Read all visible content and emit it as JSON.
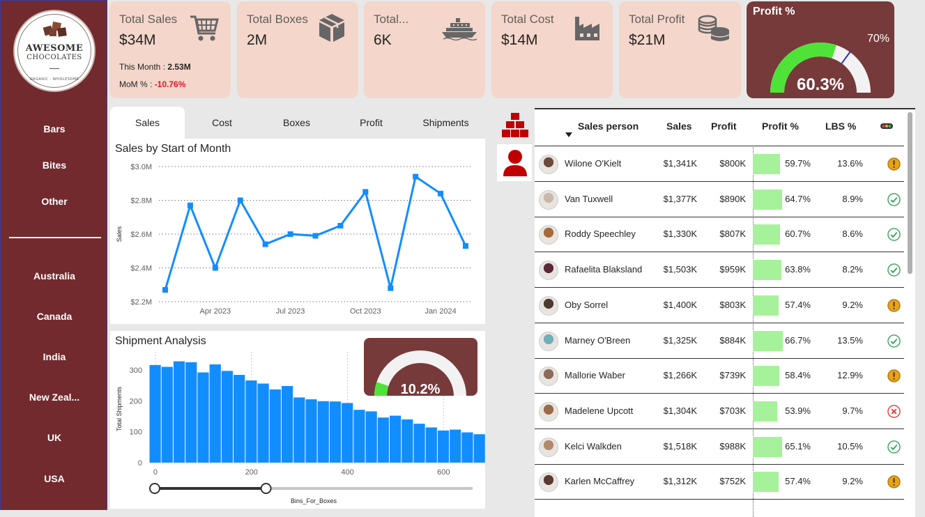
{
  "logo": {
    "title_line1": "AWESOME",
    "title_line2": "CHOCOLATES",
    "subtitle": "ORGANIC · WHOLESOME"
  },
  "nav": {
    "products": [
      "Bars",
      "Bites",
      "Other"
    ],
    "countries": [
      "Australia",
      "Canada",
      "India",
      "New Zeal...",
      "UK",
      "USA"
    ]
  },
  "kpis": [
    {
      "label": "Total Sales",
      "value": "$34M",
      "icon": "shopping-cart-icon"
    },
    {
      "label": "Total Boxes",
      "value": "2M",
      "icon": "box-icon"
    },
    {
      "label": "Total...",
      "value": "6K",
      "icon": "ship-icon"
    },
    {
      "label": "Total Cost",
      "value": "$14M",
      "icon": "factory-icon"
    },
    {
      "label": "Total Profit",
      "value": "$21M",
      "icon": "coins-icon"
    }
  ],
  "sales_extra": {
    "this_month_label": "This Month : ",
    "this_month_value": "2.53M",
    "mom_label": "MoM % : ",
    "mom_value": "-10.76%"
  },
  "profit_gauge": {
    "title": "Profit %",
    "value_text": "60.3%",
    "target_text": "70%",
    "value": 60.3,
    "target": 70,
    "max": 100,
    "fill_color": "#4fe33a",
    "track_color": "#f2f2f2",
    "target_color": "#2c2cc4"
  },
  "tabs": [
    "Sales",
    "Cost",
    "Boxes",
    "Profit",
    "Shipments"
  ],
  "active_tab": "Sales",
  "icon_strip": [
    {
      "icon": "stacked-boxes-icon"
    },
    {
      "icon": "person-icon"
    }
  ],
  "chart_data": [
    {
      "type": "line",
      "title": "Sales by Start of Month",
      "xlabel": "",
      "ylabel": "Sales",
      "x": [
        "Feb 2023",
        "Mar 2023",
        "Apr 2023",
        "May 2023",
        "Jun 2023",
        "Jul 2023",
        "Aug 2023",
        "Sep 2023",
        "Oct 2023",
        "Nov 2023",
        "Dec 2023",
        "Jan 2024",
        "Feb 2024"
      ],
      "values": [
        2.27,
        2.77,
        2.4,
        2.8,
        2.54,
        2.6,
        2.59,
        2.65,
        2.85,
        2.28,
        2.94,
        2.84,
        2.53
      ],
      "x_tick_labels": [
        "Apr 2023",
        "Jul 2023",
        "Oct 2023",
        "Jan 2024"
      ],
      "x_tick_positions": [
        "Apr 2023",
        "Jul 2023",
        "Oct 2023",
        "Jan 2024"
      ],
      "y_ticks": [
        2.2,
        2.4,
        2.6,
        2.8,
        3.0
      ],
      "y_tick_labels": [
        "$2.2M",
        "$2.4M",
        "$2.6M",
        "$2.8M",
        "$3.0M"
      ],
      "ylim": [
        2.2,
        3.0
      ],
      "color": "#118dff",
      "grid": true
    },
    {
      "type": "bar",
      "title": "Shipment Analysis",
      "xlabel": "Bins_For_Boxes",
      "ylabel": "Total Shipments",
      "bin_width": 25,
      "x_start": -13,
      "values": [
        316,
        310,
        328,
        325,
        292,
        318,
        297,
        284,
        266,
        256,
        237,
        248,
        211,
        205,
        199,
        198,
        193,
        171,
        166,
        146,
        152,
        140,
        126,
        114,
        104,
        107,
        98,
        92,
        82,
        76,
        72,
        68,
        63,
        59,
        51
      ],
      "x_tick_labels": [
        "0",
        "200",
        "400",
        "600"
      ],
      "x_ticks": [
        0,
        200,
        400,
        600
      ],
      "y_ticks": [
        0,
        100,
        200,
        300
      ],
      "y_tick_labels": [
        "0",
        "100",
        "200",
        "300"
      ],
      "ylim": [
        0,
        345
      ],
      "xlim": [
        -13,
        675
      ],
      "color": "#118dff",
      "grid": true
    }
  ],
  "shipment_gauge": {
    "value_text": "10.2%",
    "value": 10.2,
    "max": 100,
    "fill_color": "#4fe33a",
    "track_color": "#f2f2f2"
  },
  "range_slider": {
    "min_handle": 0,
    "max_handle": 0.35
  },
  "table": {
    "headers": {
      "name": "Sales person",
      "sales": "Sales",
      "profit": "Profit",
      "profit_pct": "Profit %",
      "lbs": "LBS %"
    },
    "status_legend_icon": "traffic-light-icon",
    "rows": [
      {
        "name": "Wilone O'Kielt",
        "sales": "$1,341K",
        "profit": "$800K",
        "profit_pct": "59.7%",
        "pct": 59.7,
        "lbs": "13.6%",
        "status": "warning",
        "avatar": "#6b4a3a"
      },
      {
        "name": "Van Tuxwell",
        "sales": "$1,377K",
        "profit": "$890K",
        "profit_pct": "64.7%",
        "pct": 64.7,
        "lbs": "8.9%",
        "status": "ok",
        "avatar": "#c9b8a8"
      },
      {
        "name": "Roddy Speechley",
        "sales": "$1,330K",
        "profit": "$807K",
        "profit_pct": "60.7%",
        "pct": 60.7,
        "lbs": "8.6%",
        "status": "ok",
        "avatar": "#a66a3a"
      },
      {
        "name": "Rafaelita Blaksland",
        "sales": "$1,503K",
        "profit": "$959K",
        "profit_pct": "63.8%",
        "pct": 63.8,
        "lbs": "8.2%",
        "status": "ok",
        "avatar": "#5a2a3a"
      },
      {
        "name": "Oby Sorrel",
        "sales": "$1,400K",
        "profit": "$803K",
        "profit_pct": "57.4%",
        "pct": 57.4,
        "lbs": "9.2%",
        "status": "warning",
        "avatar": "#4a3a30"
      },
      {
        "name": "Marney O'Breen",
        "sales": "$1,325K",
        "profit": "$884K",
        "profit_pct": "66.7%",
        "pct": 66.7,
        "lbs": "13.5%",
        "status": "ok",
        "avatar": "#6fb0b8"
      },
      {
        "name": "Mallorie Waber",
        "sales": "$1,266K",
        "profit": "$739K",
        "profit_pct": "58.4%",
        "pct": 58.4,
        "lbs": "12.9%",
        "status": "warning",
        "avatar": "#8a6a5a"
      },
      {
        "name": "Madelene Upcott",
        "sales": "$1,304K",
        "profit": "$703K",
        "profit_pct": "53.9%",
        "pct": 53.9,
        "lbs": "9.7%",
        "status": "error",
        "avatar": "#9a6a4a"
      },
      {
        "name": "Kelci Walkden",
        "sales": "$1,518K",
        "profit": "$988K",
        "profit_pct": "65.1%",
        "pct": 65.1,
        "lbs": "10.5%",
        "status": "ok",
        "avatar": "#b08a6a"
      },
      {
        "name": "Karlen McCaffrey",
        "sales": "$1,312K",
        "profit": "$752K",
        "profit_pct": "57.4%",
        "pct": 57.4,
        "lbs": "9.2%",
        "status": "warning",
        "avatar": "#5a3a30"
      }
    ]
  },
  "colors": {
    "sidebar": "#722a2e",
    "kpi_card": "#f4d6cb",
    "gauge_card": "#773a3a",
    "accent_red": "#c00000",
    "ok": "#3aa35b",
    "warning": "#e8a317",
    "error": "#e03a3a"
  }
}
